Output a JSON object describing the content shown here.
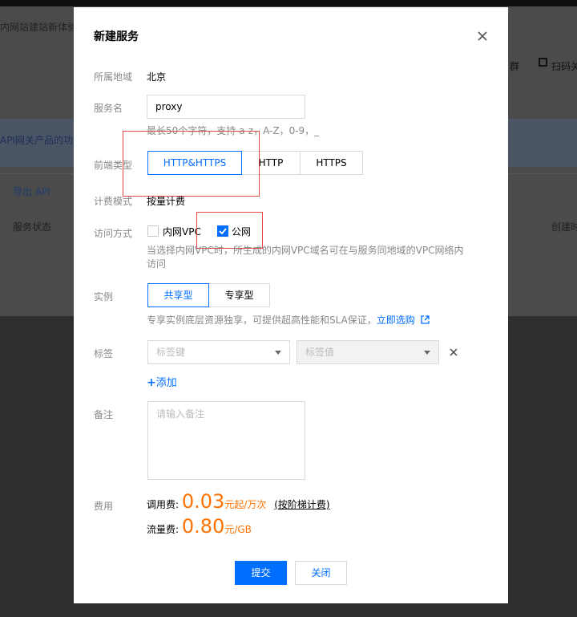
{
  "background": {
    "banner_text": "内网站建站新体验",
    "strip_text": "API网关产品的功能",
    "api_link": "导出 API",
    "status_col": "服务状态",
    "right_text_1": "群",
    "right_text_2": "扫码关",
    "right_text_3": "创建时"
  },
  "modal": {
    "title": "新建服务",
    "close_icon": "close-icon",
    "region": {
      "label": "所属地域",
      "value": "北京"
    },
    "service_name": {
      "label": "服务名",
      "value": "proxy",
      "hint": "最长50个字符，支持 a-z，A-Z，0-9，_"
    },
    "frontend_type": {
      "label": "前端类型",
      "options": [
        "HTTP&HTTPS",
        "HTTP",
        "HTTPS"
      ],
      "selected": "HTTP&HTTPS"
    },
    "billing_mode": {
      "label": "计费模式",
      "value": "按量计费"
    },
    "access": {
      "label": "访问方式",
      "vpc_label": "内网VPC",
      "vpc_checked": false,
      "public_label": "公网",
      "public_checked": true,
      "hint": "当选择内网VPC时，所生成的内网VPC域名可在与服务同地域的VPC网络内访问"
    },
    "instance": {
      "label": "实例",
      "options": [
        "共享型",
        "专享型"
      ],
      "selected": "共享型",
      "hint": "专享实例底层资源独享，可提供超高性能和SLA保证，",
      "link": "立即选购",
      "link_icon": "external-link-icon"
    },
    "tags": {
      "label": "标签",
      "key_placeholder": "标签键",
      "value_placeholder": "标签值",
      "add_label": "添加",
      "remove_icon": "close-icon"
    },
    "remark": {
      "label": "备注",
      "placeholder": "请输入备注"
    },
    "fees": {
      "label": "费用",
      "call_label": "调用费:",
      "call_price": "0.03",
      "call_unit": "元起/万次",
      "call_note": "(按阶梯计费)",
      "traffic_label": "流量费:",
      "traffic_price": "0.80",
      "traffic_unit": "元/GB"
    },
    "buttons": {
      "submit": "提交",
      "close": "关闭"
    }
  },
  "colors": {
    "primary": "#006eff",
    "price": "#ff7200",
    "annotation_box": "#e54545"
  }
}
